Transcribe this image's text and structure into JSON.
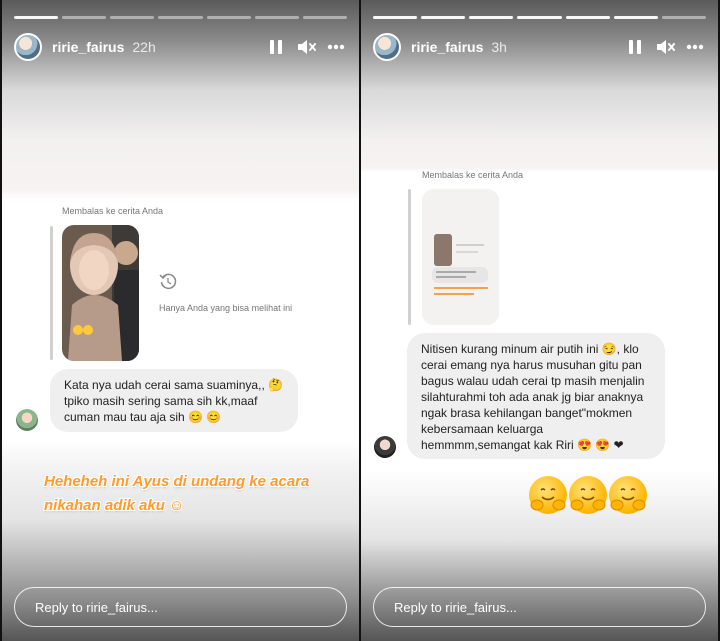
{
  "left_story": {
    "username": "ririe_fairus",
    "time": "22h",
    "reply_label": "Membalas ke cerita Anda",
    "only_you_text": "Hanya Anda yang bisa melihat ini",
    "message": "Kata nya udah cerai sama suaminya,, 🤔\ntpiko masih sering sama sih kk,maaf\ncuman mau tau aja sih 😊 😊",
    "caption": "Heheheh ini Ayus di undang ke acara\nnikahan adik aku ☺",
    "reply_placeholder": "Reply to ririe_fairus..."
  },
  "right_story": {
    "username": "ririe_fairus",
    "time": "3h",
    "reply_label": "Membalas ke cerita Anda",
    "message": "Nitisen kurang minum air putih ini 😏, klo\ncerai emang nya harus musuhan gitu pan\nbagus walau udah cerai tp masih menjalin\nsilahturahmi toh ada anak jg biar anaknya\nngak brasa kehilangan banget\"mokmen\nkebersamaan keluarga\nhemmmm,semangat kak Riri 😍 😍 ❤",
    "reply_placeholder": "Reply to ririe_fairus..."
  },
  "progress": {
    "left_segments": 7,
    "left_completed": 1,
    "right_segments": 7,
    "right_completed": 6
  },
  "icons": [
    "pause-icon",
    "mute-icon",
    "more-icon",
    "replay-icon"
  ],
  "colors": {
    "caption": "#ff9a2e",
    "bubble": "#efefef",
    "text_muted": "#777777"
  }
}
